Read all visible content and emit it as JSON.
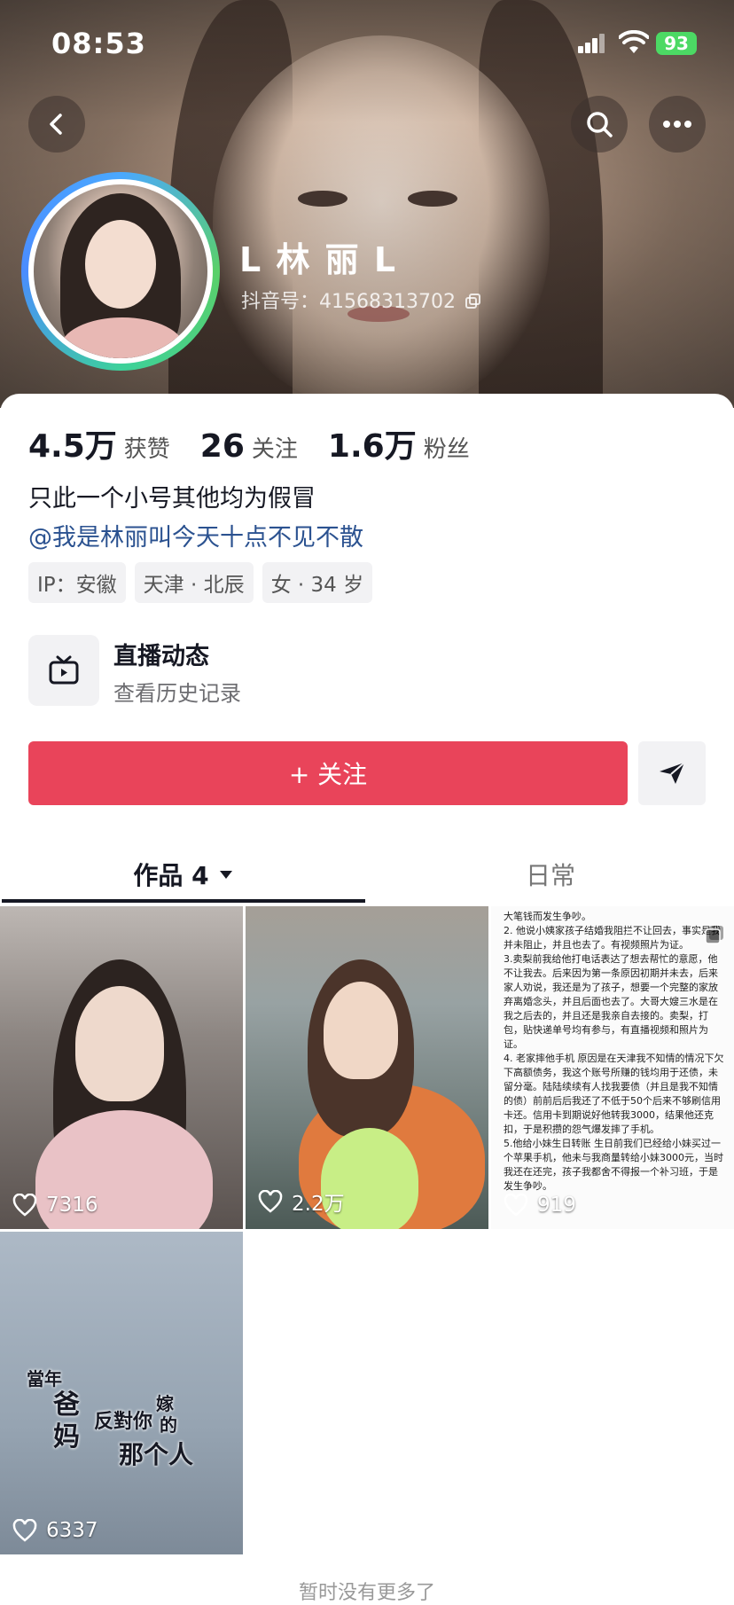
{
  "status_bar": {
    "time": "08:53",
    "battery": "93"
  },
  "profile": {
    "name": "L 林 丽 L",
    "douyin_id": "抖音号：41568313702"
  },
  "stats": [
    {
      "num": "4.5万",
      "label": "获赞"
    },
    {
      "num": "26",
      "label": "关注"
    },
    {
      "num": "1.6万",
      "label": "粉丝"
    }
  ],
  "bio": {
    "line1": "只此一个小号其他均为假冒",
    "mention": "@我是林丽叫今天十点不见不散"
  },
  "tags": [
    "IP：安徽",
    "天津 · 北辰",
    "女 · 34 岁"
  ],
  "live": {
    "title": "直播动态",
    "subtitle": "查看历史记录"
  },
  "actions": {
    "follow": "+ 关注"
  },
  "tabs": {
    "works": "作品 4",
    "daily": "日常"
  },
  "videos": [
    {
      "likes": "7316"
    },
    {
      "likes": "2.2万"
    },
    {
      "likes": "919",
      "note_lines": [
        "大笔钱而发生争吵。",
        "2. 他说小姨家孩子结婚我阻拦不让回去，事实是我并未阻止，并且也去了。有视频照片为证。",
        "3.卖梨前我给他打电话表达了想去帮忙的意愿，他不让我去。后来因为第一条原因初期并未去，后来家人劝说，我还是为了孩子，想要一个完整的家放弃离婚念头，并且后面也去了。大哥大嫂三水是在我之后去的，并且还是我亲自去接的。卖梨，打包，贴快递单号均有参与，有直播视频和照片为证。",
        "4. 老家摔他手机 原因是在天津我不知情的情况下欠下高额债务，我这个账号所赚的钱均用于还债，未留分毫。陆陆续续有人找我要债（并且是我不知情的债）前前后后我还了不低于50个后来不够刷信用卡还。信用卡到期说好他转我3000，结果他还克扣，于是积攒的怨气爆发摔了手机。",
        "5.他给小妹生日转账 生日前我们已经给小妹买过一个苹果手机，他未与我商量转给小妹3000元，当时我还在还完，孩子我都舍不得报一个补习班，于是发生争吵。"
      ]
    },
    {
      "likes": "6337",
      "caption": [
        "當年",
        "爸",
        "妈",
        "反對你",
        "嫁",
        "的",
        "那个人"
      ]
    }
  ],
  "footer": "暂时没有更多了",
  "colors": {
    "follow": "#e9445a",
    "mention": "#2b5290",
    "battery": "#4cd964"
  }
}
